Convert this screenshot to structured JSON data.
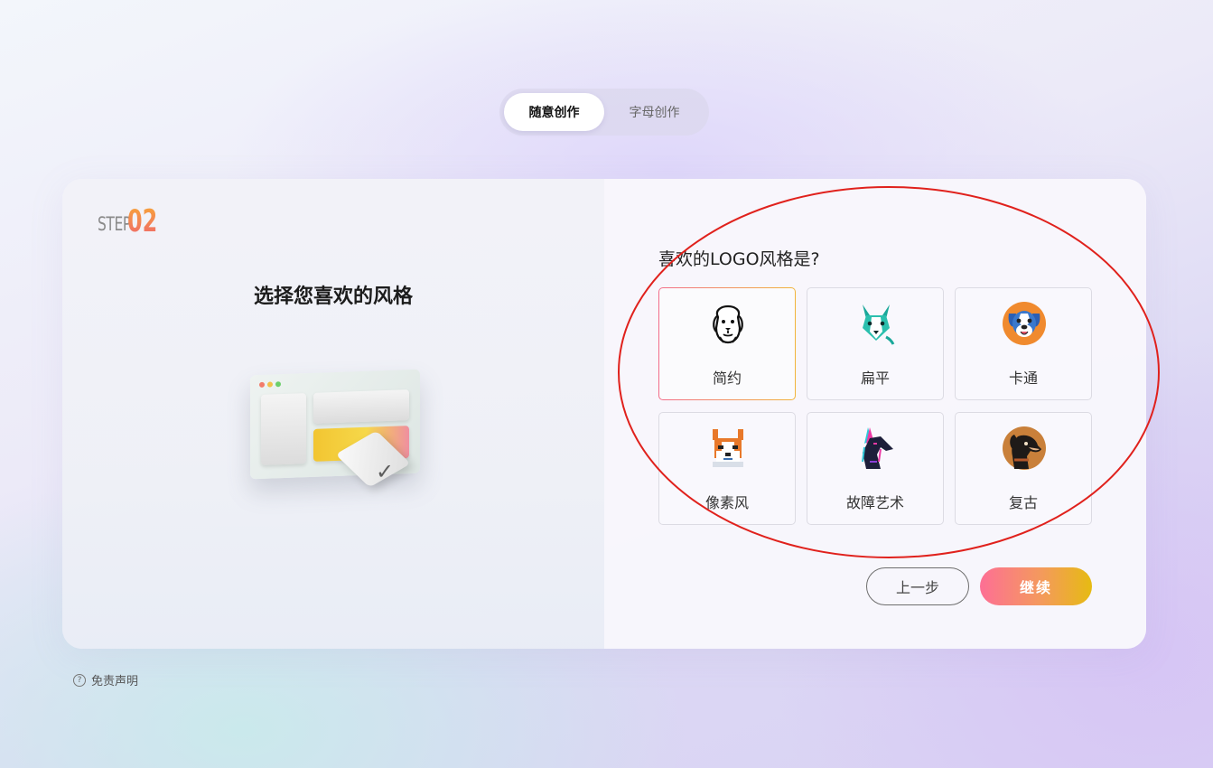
{
  "tabs": [
    {
      "label": "随意创作",
      "active": true
    },
    {
      "label": "字母创作",
      "active": false
    }
  ],
  "step": {
    "word": "STEP",
    "number": "02"
  },
  "left": {
    "title": "选择您喜欢的风格"
  },
  "right": {
    "question": "喜欢的LOGO风格是?",
    "options": [
      {
        "label": "简约",
        "icon": "minimal-dog-icon",
        "selected": true
      },
      {
        "label": "扁平",
        "icon": "flat-dog-icon",
        "selected": false
      },
      {
        "label": "卡通",
        "icon": "cartoon-dog-icon",
        "selected": false
      },
      {
        "label": "像素风",
        "icon": "pixel-dog-icon",
        "selected": false
      },
      {
        "label": "故障艺术",
        "icon": "glitch-dog-icon",
        "selected": false
      },
      {
        "label": "复古",
        "icon": "retro-dog-icon",
        "selected": false
      }
    ]
  },
  "buttons": {
    "prev": "上一步",
    "next": "继续"
  },
  "footer": {
    "disclaimer": "免责声明"
  },
  "colors": {
    "accent_start": "#fd6f95",
    "accent_end": "#e6bb12",
    "annotation": "#e0211c"
  }
}
